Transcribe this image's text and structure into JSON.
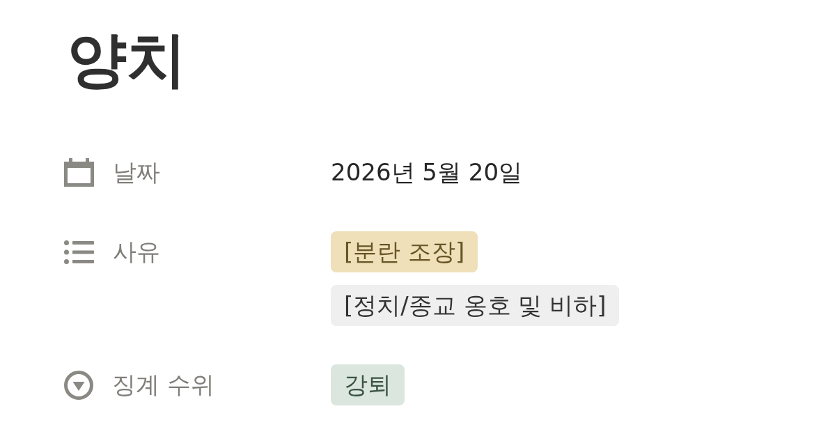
{
  "title": "양치",
  "properties": [
    {
      "kind": "date",
      "name": "날짜",
      "value": "2026년 5월 20일"
    },
    {
      "kind": "multi_select",
      "name": "사유",
      "tags": [
        {
          "label": "[분란 조장]",
          "color": "#efe0b9"
        },
        {
          "label": "[정치/종교 옹호 및 비하]",
          "color": "#efefef"
        }
      ]
    },
    {
      "kind": "select",
      "name": "징계 수위",
      "tags": [
        {
          "label": "강퇴",
          "color": "#dbe6de"
        }
      ]
    }
  ]
}
